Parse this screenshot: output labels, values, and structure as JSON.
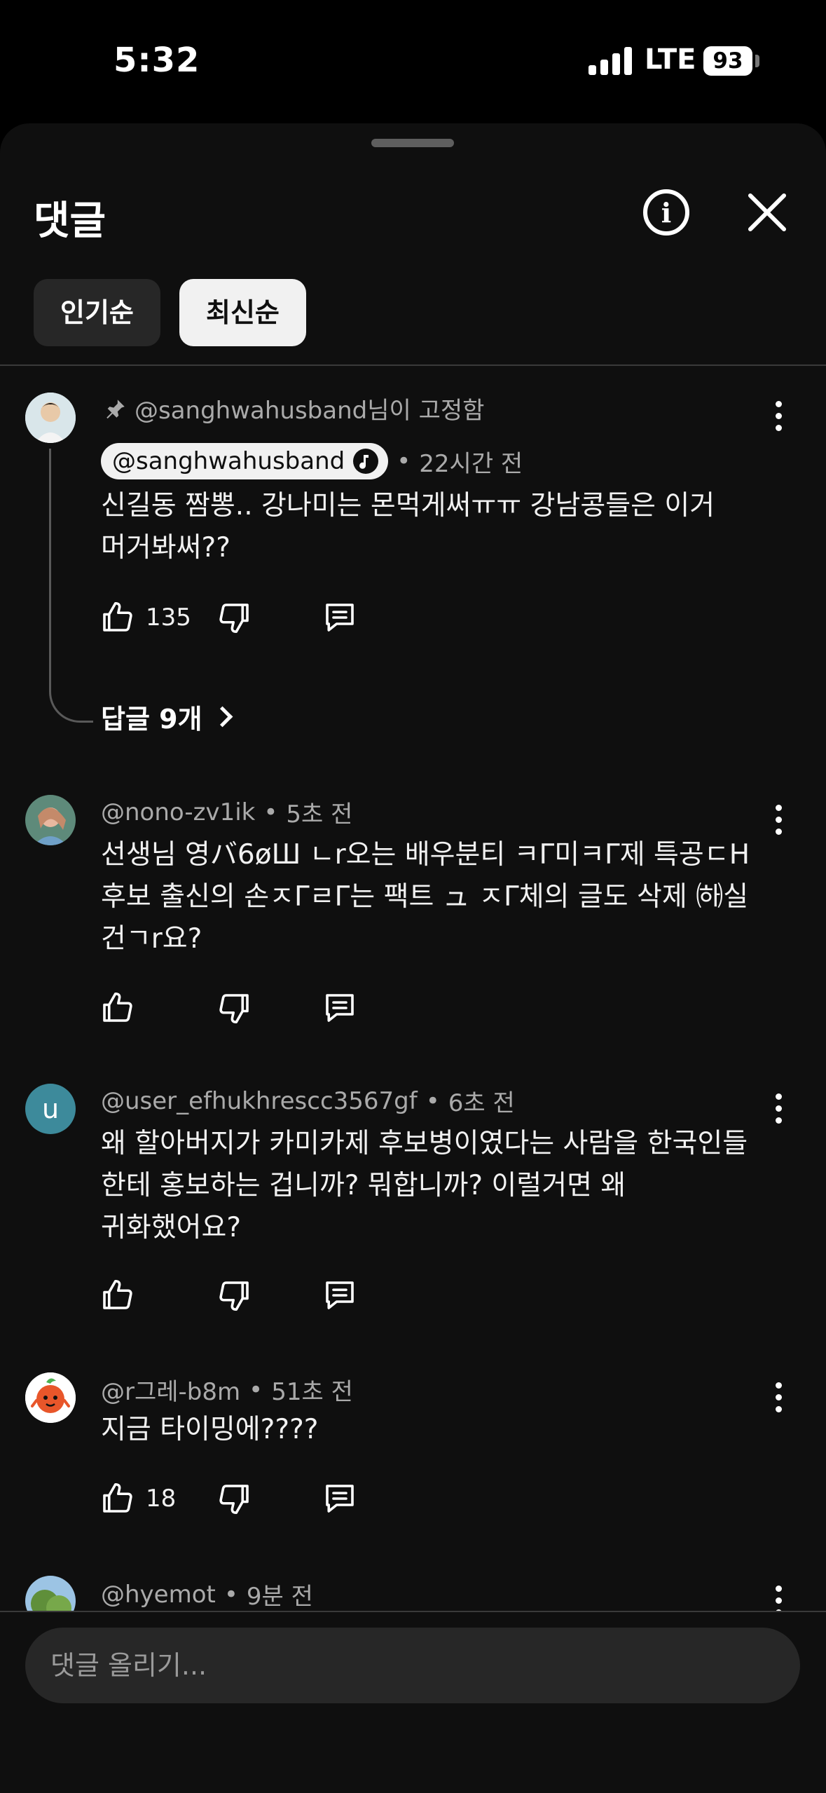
{
  "status_bar": {
    "time": "5:32",
    "network": "LTE",
    "battery": "93"
  },
  "header": {
    "title": "댓글",
    "info_icon": "info-icon",
    "close_icon": "close-icon"
  },
  "sort": {
    "popular": "인기순",
    "newest": "최신순",
    "selected": "최신순"
  },
  "comments": [
    {
      "pinned_label": "@sanghwahusband님이 고정함",
      "author": "@sanghwahusband",
      "time": "22시간 전",
      "text": "신길동 짬뽕.. 강나미는 몬먹게써ㅠㅠ 강남콩들은 이거 머거봐써??",
      "likes": "135",
      "replies_label": "답글 9개"
    },
    {
      "author": "@nono-zv1ik",
      "time": "5초 전",
      "text": "선생님 영バ6øШ ㄴr오는 배우분티 ㅋΓ미ㅋΓ제 특공ㄷH 후보 출신의 손ㅈΓㄹΓ는 팩트 ュ ㅈΓ체의 글도 삭제 ㈛실 건ㄱr요?",
      "likes": ""
    },
    {
      "author": "@user_efhukhrescc3567gf",
      "avatar_letter": "u",
      "time": "6초 전",
      "text": "왜 할아버지가 카미카제 후보병이였다는 사람을 한국인들 한테 홍보하는 겁니까? 뭐합니까? 이럴거면 왜 귀화했어요?",
      "likes": ""
    },
    {
      "author": "@r그레-b8m",
      "time": "51초 전",
      "text": "지금 타이밍에????",
      "likes": "18"
    },
    {
      "author": "@hyemot",
      "time": "9분 전"
    }
  ],
  "input": {
    "placeholder": "댓글 올리기..."
  },
  "colors": {
    "background": "#0f0f0f",
    "chip_selected": "#f1f1f1",
    "secondary_text": "#aaaaaa"
  }
}
